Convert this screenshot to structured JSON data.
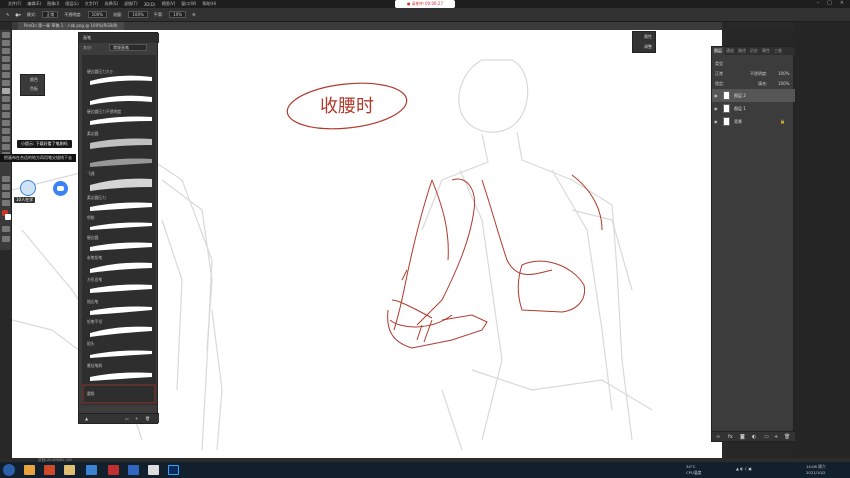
{
  "menubar": {
    "items": [
      "文件(F)",
      "编辑(E)",
      "图像(I)",
      "图层(L)",
      "文字(Y)",
      "选择(S)",
      "滤镜(T)",
      "3D(D)",
      "视图(V)",
      "窗口(W)",
      "帮助(H)"
    ],
    "recording": "● 录制中 00:06:27"
  },
  "options_bar": {
    "mode_label": "模式:",
    "mode_value": "正常",
    "opacity_label": "不透明度:",
    "opacity_value": "100%",
    "flow_label": "流量:",
    "flow_value": "100%",
    "smooth_label": "平滑:",
    "smooth_value": "10%"
  },
  "doc_tab": "PenDn 第一章 草稿 1 · 人体.png @ 100%(RGB/8)",
  "brush_panel": {
    "title": "画笔",
    "size_label": "大小:",
    "preset": "常规画笔",
    "brushes": [
      "硬边圆压力大小",
      "硬边圆压力不透明度",
      "柔边圆",
      "飞溅",
      "柔边圆压力",
      "喷枪",
      "硬边圆",
      "炭笔铅笔",
      "方形旧笔",
      "描边笔",
      "铅笔平坦",
      "粗头",
      "最佳笔刷",
      "圆角",
      "硬笔",
      "粗边笔刷",
      "铅笔"
    ]
  },
  "left_mini_panel": {
    "items": [
      "颜色",
      "色板"
    ]
  },
  "tooltips": {
    "tip1": "小提示: 下载好看了笔刷吗",
    "tip2": "把画布在合适的地方再用笔尖描线下去"
  },
  "avatar_badge": "10人在学",
  "float_panel": {
    "items": [
      "属性",
      "调整"
    ]
  },
  "sketch_text": "收腰时",
  "layers_panel": {
    "tabs": [
      "图层",
      "通道",
      "路径",
      "历史",
      "属性",
      "三维"
    ],
    "kind": "类型",
    "blend": "正常",
    "opacity_label": "不透明度:",
    "opacity_value": "100%",
    "lock_label": "锁定:",
    "fill_label": "填充:",
    "fill_value": "100%",
    "layers": [
      {
        "name": "图层 2",
        "selected": true
      },
      {
        "name": "图层 1",
        "selected": false
      },
      {
        "name": "背景",
        "selected": false
      }
    ]
  },
  "status": {
    "zoom_info": "文档:20.0M/62.1M"
  },
  "taskbar": {
    "temp": "34°C",
    "cpu": "CPU温度",
    "time": "14:06 周六",
    "date": "2021/10/2"
  }
}
